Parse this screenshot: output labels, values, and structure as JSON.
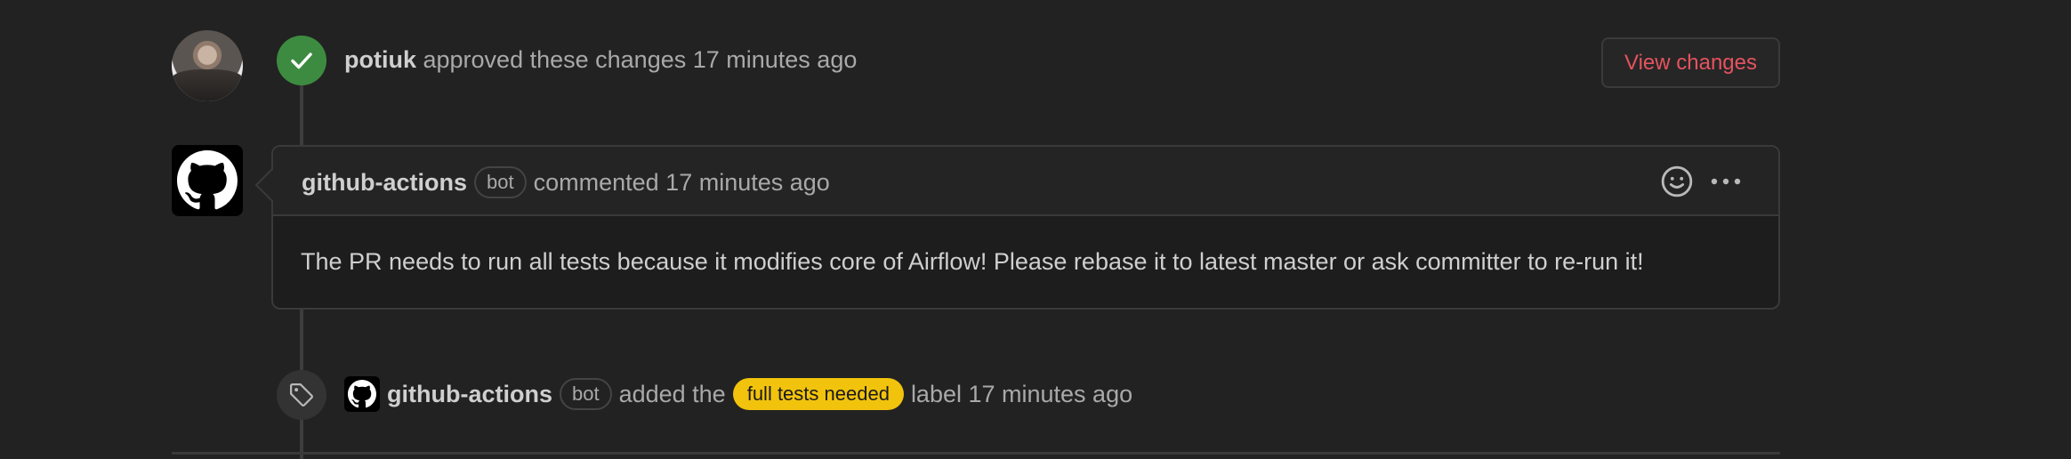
{
  "review": {
    "author": "potiuk",
    "action_text": " approved these changes ",
    "time": "17 minutes ago",
    "view_changes_label": "View changes",
    "status_color": "#3d8b40"
  },
  "comment": {
    "author": "github-actions",
    "bot_label": "bot",
    "action_text": "commented",
    "time": "17 minutes ago",
    "body": "The PR needs to run all tests because it modifies core of Airflow! Please rebase it to latest master or ask committer to re-run it!",
    "icons": [
      "smiley-icon",
      "kebab-horizontal-icon"
    ]
  },
  "label_event": {
    "author": "github-actions",
    "bot_label": "bot",
    "before_text": "added the",
    "label_name": "full tests needed",
    "label_color": "#f2c30c",
    "after_text": "label 17 minutes ago",
    "icon": "tag-icon"
  }
}
